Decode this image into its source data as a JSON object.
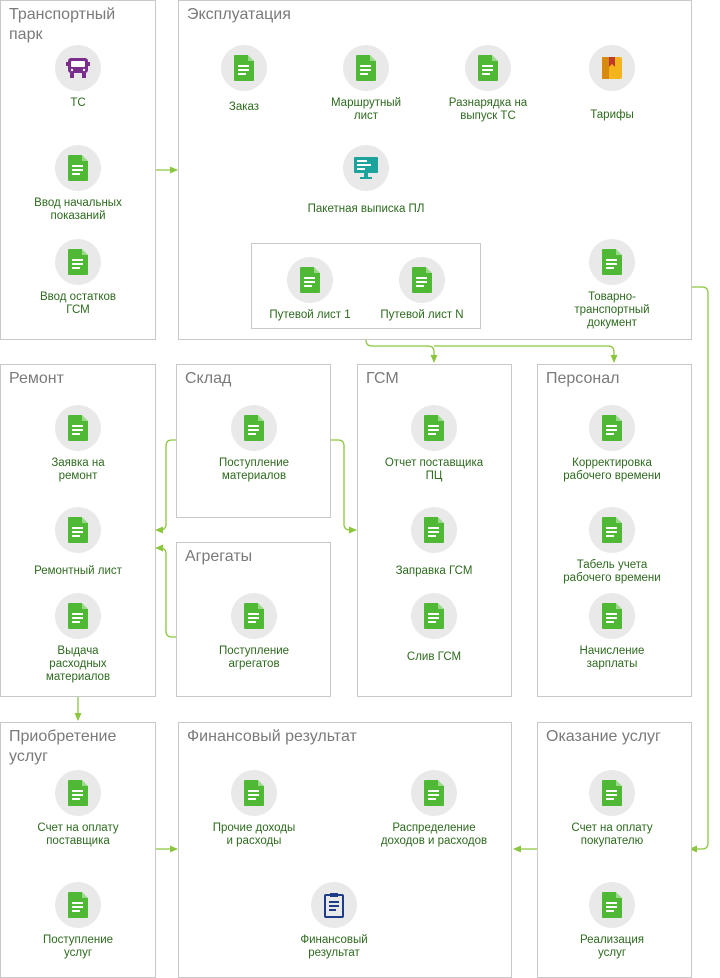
{
  "colors": {
    "accent_green": "#4fb935",
    "label_green": "#2d6a1e",
    "title_gray": "#7a7a7a",
    "panel_border": "#c8c8c8",
    "line": "#8cc63f"
  },
  "panels": {
    "transport_park": "Транспортный\nпарк",
    "exploitation": "Эксплуатация",
    "repair": "Ремонт",
    "warehouse": "Склад",
    "aggregates": "Агрегаты",
    "fuel": "ГСМ",
    "personnel": "Персонал",
    "purchase_services": "Приобретение\nуслуг",
    "financial_result": "Финансовый результат",
    "providing_services": "Оказание услуг"
  },
  "nodes": {
    "vehicles": {
      "label": "ТС",
      "icon": "truck-icon"
    },
    "initial_readings": {
      "label": "Ввод начальных\nпоказаний",
      "icon": "document-icon"
    },
    "fuel_balances": {
      "label": "Ввод остатков\nГСМ",
      "icon": "document-icon"
    },
    "order": {
      "label": "Заказ",
      "icon": "document-icon"
    },
    "route_sheet": {
      "label": "Маршрутный\nлист",
      "icon": "document-icon"
    },
    "dispatch_order": {
      "label": "Разнарядка на\nвыпуск ТС",
      "icon": "document-icon"
    },
    "tariffs": {
      "label": "Тарифы",
      "icon": "book-icon"
    },
    "batch_issue": {
      "label": "Пакетная выписка ПЛ",
      "icon": "monitor-icon"
    },
    "waybill_1": {
      "label": "Путевой лист 1",
      "icon": "document-icon"
    },
    "waybill_n": {
      "label": "Путевой лист N",
      "icon": "document-icon"
    },
    "consignment_note": {
      "label": "Товарно-\nтранспортный\nдокумент",
      "icon": "document-icon"
    },
    "repair_request": {
      "label": "Заявка на\nремонт",
      "icon": "document-icon"
    },
    "repair_sheet": {
      "label": "Ремонтный лист",
      "icon": "document-icon"
    },
    "materials_issue": {
      "label": "Выдача\nрасходных\nматериалов",
      "icon": "document-icon"
    },
    "materials_receipt": {
      "label": "Поступление\nматериалов",
      "icon": "document-icon"
    },
    "aggregates_receipt": {
      "label": "Поступление\nагрегатов",
      "icon": "document-icon"
    },
    "pc_supplier_report": {
      "label": "Отчет поставщика\nПЦ",
      "icon": "document-icon"
    },
    "fuel_refill": {
      "label": "Заправка ГСМ",
      "icon": "document-icon"
    },
    "fuel_drain": {
      "label": "Слив ГСМ",
      "icon": "document-icon"
    },
    "worktime_adjust": {
      "label": "Корректировка\nрабочего времени",
      "icon": "document-icon"
    },
    "timesheet": {
      "label": "Табель учета\nрабочего времени",
      "icon": "document-icon"
    },
    "payroll": {
      "label": "Начисление\nзарплаты",
      "icon": "document-icon"
    },
    "supplier_invoice": {
      "label": "Счет на оплату\nпоставщика",
      "icon": "document-icon"
    },
    "services_receipt": {
      "label": "Поступление\nуслуг",
      "icon": "document-icon"
    },
    "other_income": {
      "label": "Прочие доходы\nи расходы",
      "icon": "document-icon"
    },
    "income_distribution": {
      "label": "Распределение\nдоходов и расходов",
      "icon": "document-icon"
    },
    "financial_result_doc": {
      "label": "Финансовый\nрезультат",
      "icon": "clipboard-icon"
    },
    "customer_invoice": {
      "label": "Счет на оплату\nпокупателю",
      "icon": "document-icon"
    },
    "sales": {
      "label": "Реализация\nуслуг",
      "icon": "document-icon"
    }
  }
}
